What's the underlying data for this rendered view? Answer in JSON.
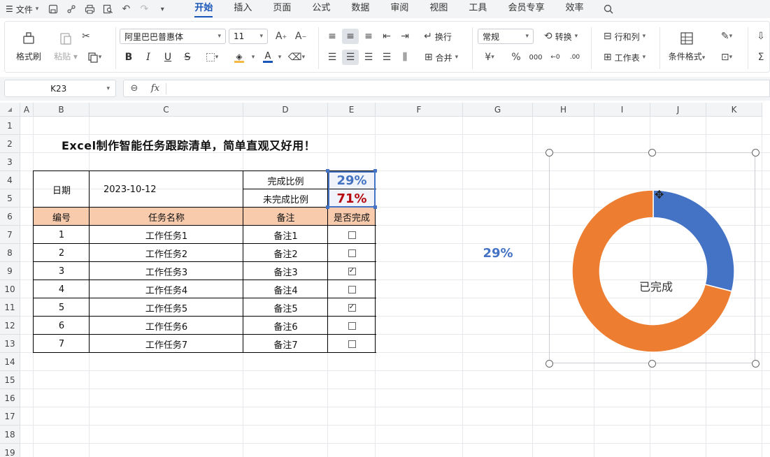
{
  "menubar": {
    "file_label": "文件",
    "tabs": [
      "开始",
      "插入",
      "页面",
      "公式",
      "数据",
      "审阅",
      "视图",
      "工具",
      "会员专享",
      "效率"
    ],
    "active_tab": "开始"
  },
  "ribbon": {
    "format_painter": "格式刷",
    "paste": "粘贴",
    "font_name": "阿里巴巴普惠体",
    "font_size": "11",
    "wrap": "换行",
    "merge": "合并",
    "number_format": "常规",
    "convert": "转换",
    "rows_cols": "行和列",
    "worksheet": "工作表",
    "conditional_format": "条件格式",
    "bold": "B",
    "italic": "I",
    "underline": "U",
    "strike": "S"
  },
  "formula_bar": {
    "cell_ref": "K23",
    "fx": "fx",
    "content": ""
  },
  "columns": [
    "A",
    "B",
    "C",
    "D",
    "E",
    "F",
    "G",
    "H",
    "I",
    "J",
    "K"
  ],
  "rows": [
    "1",
    "2",
    "3",
    "4",
    "5",
    "6",
    "7",
    "8",
    "9",
    "10",
    "11",
    "12",
    "13",
    "14",
    "15",
    "16",
    "17",
    "18",
    "19"
  ],
  "sheet": {
    "title": "Excel制作智能任务跟踪清单，简单直观又好用！",
    "date_label": "日期",
    "date_value": "2023-10-12",
    "done_label": "完成比例",
    "done_value": "29%",
    "undone_label": "未完成比例",
    "undone_value": "71%",
    "headers": [
      "编号",
      "任务名称",
      "备注",
      "是否完成"
    ],
    "tasks": [
      {
        "no": "1",
        "name": "工作任务1",
        "note": "备注1",
        "done": false
      },
      {
        "no": "2",
        "name": "工作任务2",
        "note": "备注2",
        "done": false
      },
      {
        "no": "3",
        "name": "工作任务3",
        "note": "备注3",
        "done": true
      },
      {
        "no": "4",
        "name": "工作任务4",
        "note": "备注4",
        "done": false
      },
      {
        "no": "5",
        "name": "工作任务5",
        "note": "备注5",
        "done": true
      },
      {
        "no": "6",
        "name": "工作任务6",
        "note": "备注6",
        "done": false
      },
      {
        "no": "7",
        "name": "工作任务7",
        "note": "备注7",
        "done": false
      }
    ],
    "g8_value": "29%"
  },
  "colors": {
    "header_fill": "#f8cbad",
    "done_blue": "#4472c4",
    "undone_red": "#c00000",
    "donut_done": "#4472c4",
    "donut_undone": "#ed7d31",
    "accent": "#1a56b8"
  },
  "chart_data": {
    "type": "pie",
    "hole": 0.66,
    "center_label": "已完成",
    "slices": [
      {
        "label": "完成比例",
        "value": 29,
        "color": "#4472c4"
      },
      {
        "label": "未完成比例",
        "value": 71,
        "color": "#ed7d31"
      }
    ]
  }
}
